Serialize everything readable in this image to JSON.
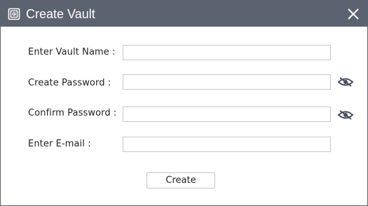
{
  "window": {
    "title": "Create Vault",
    "icon": "vault-icon",
    "close_icon": "close-icon",
    "titlebar_color": "#5d6270"
  },
  "form": {
    "vault_name": {
      "label": "Enter Vault Name :",
      "value": "",
      "placeholder": ""
    },
    "password": {
      "label": "Create Password :",
      "value": "",
      "placeholder": "",
      "toggle_icon": "eye-slash-icon"
    },
    "confirm_password": {
      "label": "Confirm Password :",
      "value": "",
      "placeholder": "",
      "toggle_icon": "eye-slash-icon"
    },
    "email": {
      "label": "Enter E-mail :",
      "value": "",
      "placeholder": ""
    }
  },
  "actions": {
    "create_label": "Create"
  }
}
